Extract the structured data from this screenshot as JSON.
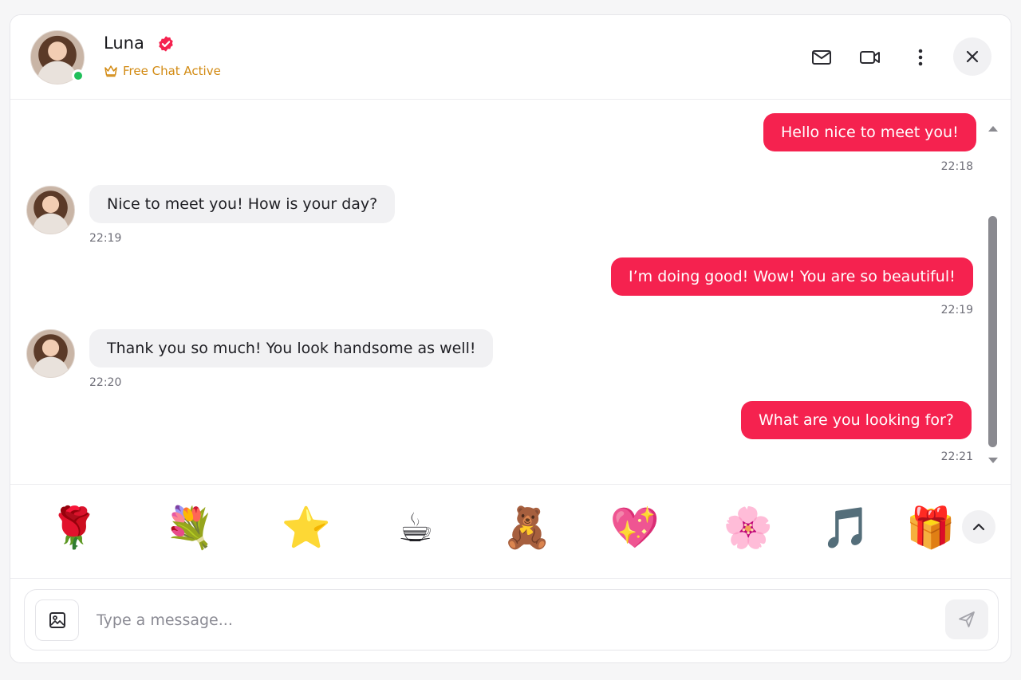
{
  "header": {
    "name": "Luna",
    "status": "Free Chat Active",
    "icons": [
      "verified-icon",
      "crown-icon",
      "mail-icon",
      "video-icon",
      "more-icon",
      "close-icon"
    ]
  },
  "messages": [
    {
      "direction": "out",
      "text": "Hello nice to meet you!",
      "time": "22:18"
    },
    {
      "direction": "in",
      "text": "Nice to meet you! How is your day?",
      "time": "22:19"
    },
    {
      "direction": "out",
      "text": "I’m doing good! Wow! You are so beautiful!",
      "time": "22:19"
    },
    {
      "direction": "in",
      "text": "Thank you so much! You look handsome as well!",
      "time": "22:20"
    },
    {
      "direction": "out",
      "text": "What are you looking for?",
      "time": "22:21"
    }
  ],
  "gifts": [
    {
      "name": "rose",
      "glyph": "🌹"
    },
    {
      "name": "bouquet",
      "glyph": "💐"
    },
    {
      "name": "star-trophy",
      "glyph": "⭐"
    },
    {
      "name": "coffee",
      "glyph": "☕"
    },
    {
      "name": "teddy-bear",
      "glyph": "🧸"
    },
    {
      "name": "heart-lock",
      "glyph": "💖"
    },
    {
      "name": "perfume",
      "glyph": "🌸"
    },
    {
      "name": "music-note",
      "glyph": "🎵"
    },
    {
      "name": "gift-box",
      "glyph": "🎁"
    }
  ],
  "composer": {
    "placeholder": "Type a message...",
    "value": ""
  },
  "colors": {
    "accent": "#f5224f",
    "online": "#1fbf5a",
    "status": "#d28a12",
    "incoming_bubble": "#f1f1f3"
  }
}
